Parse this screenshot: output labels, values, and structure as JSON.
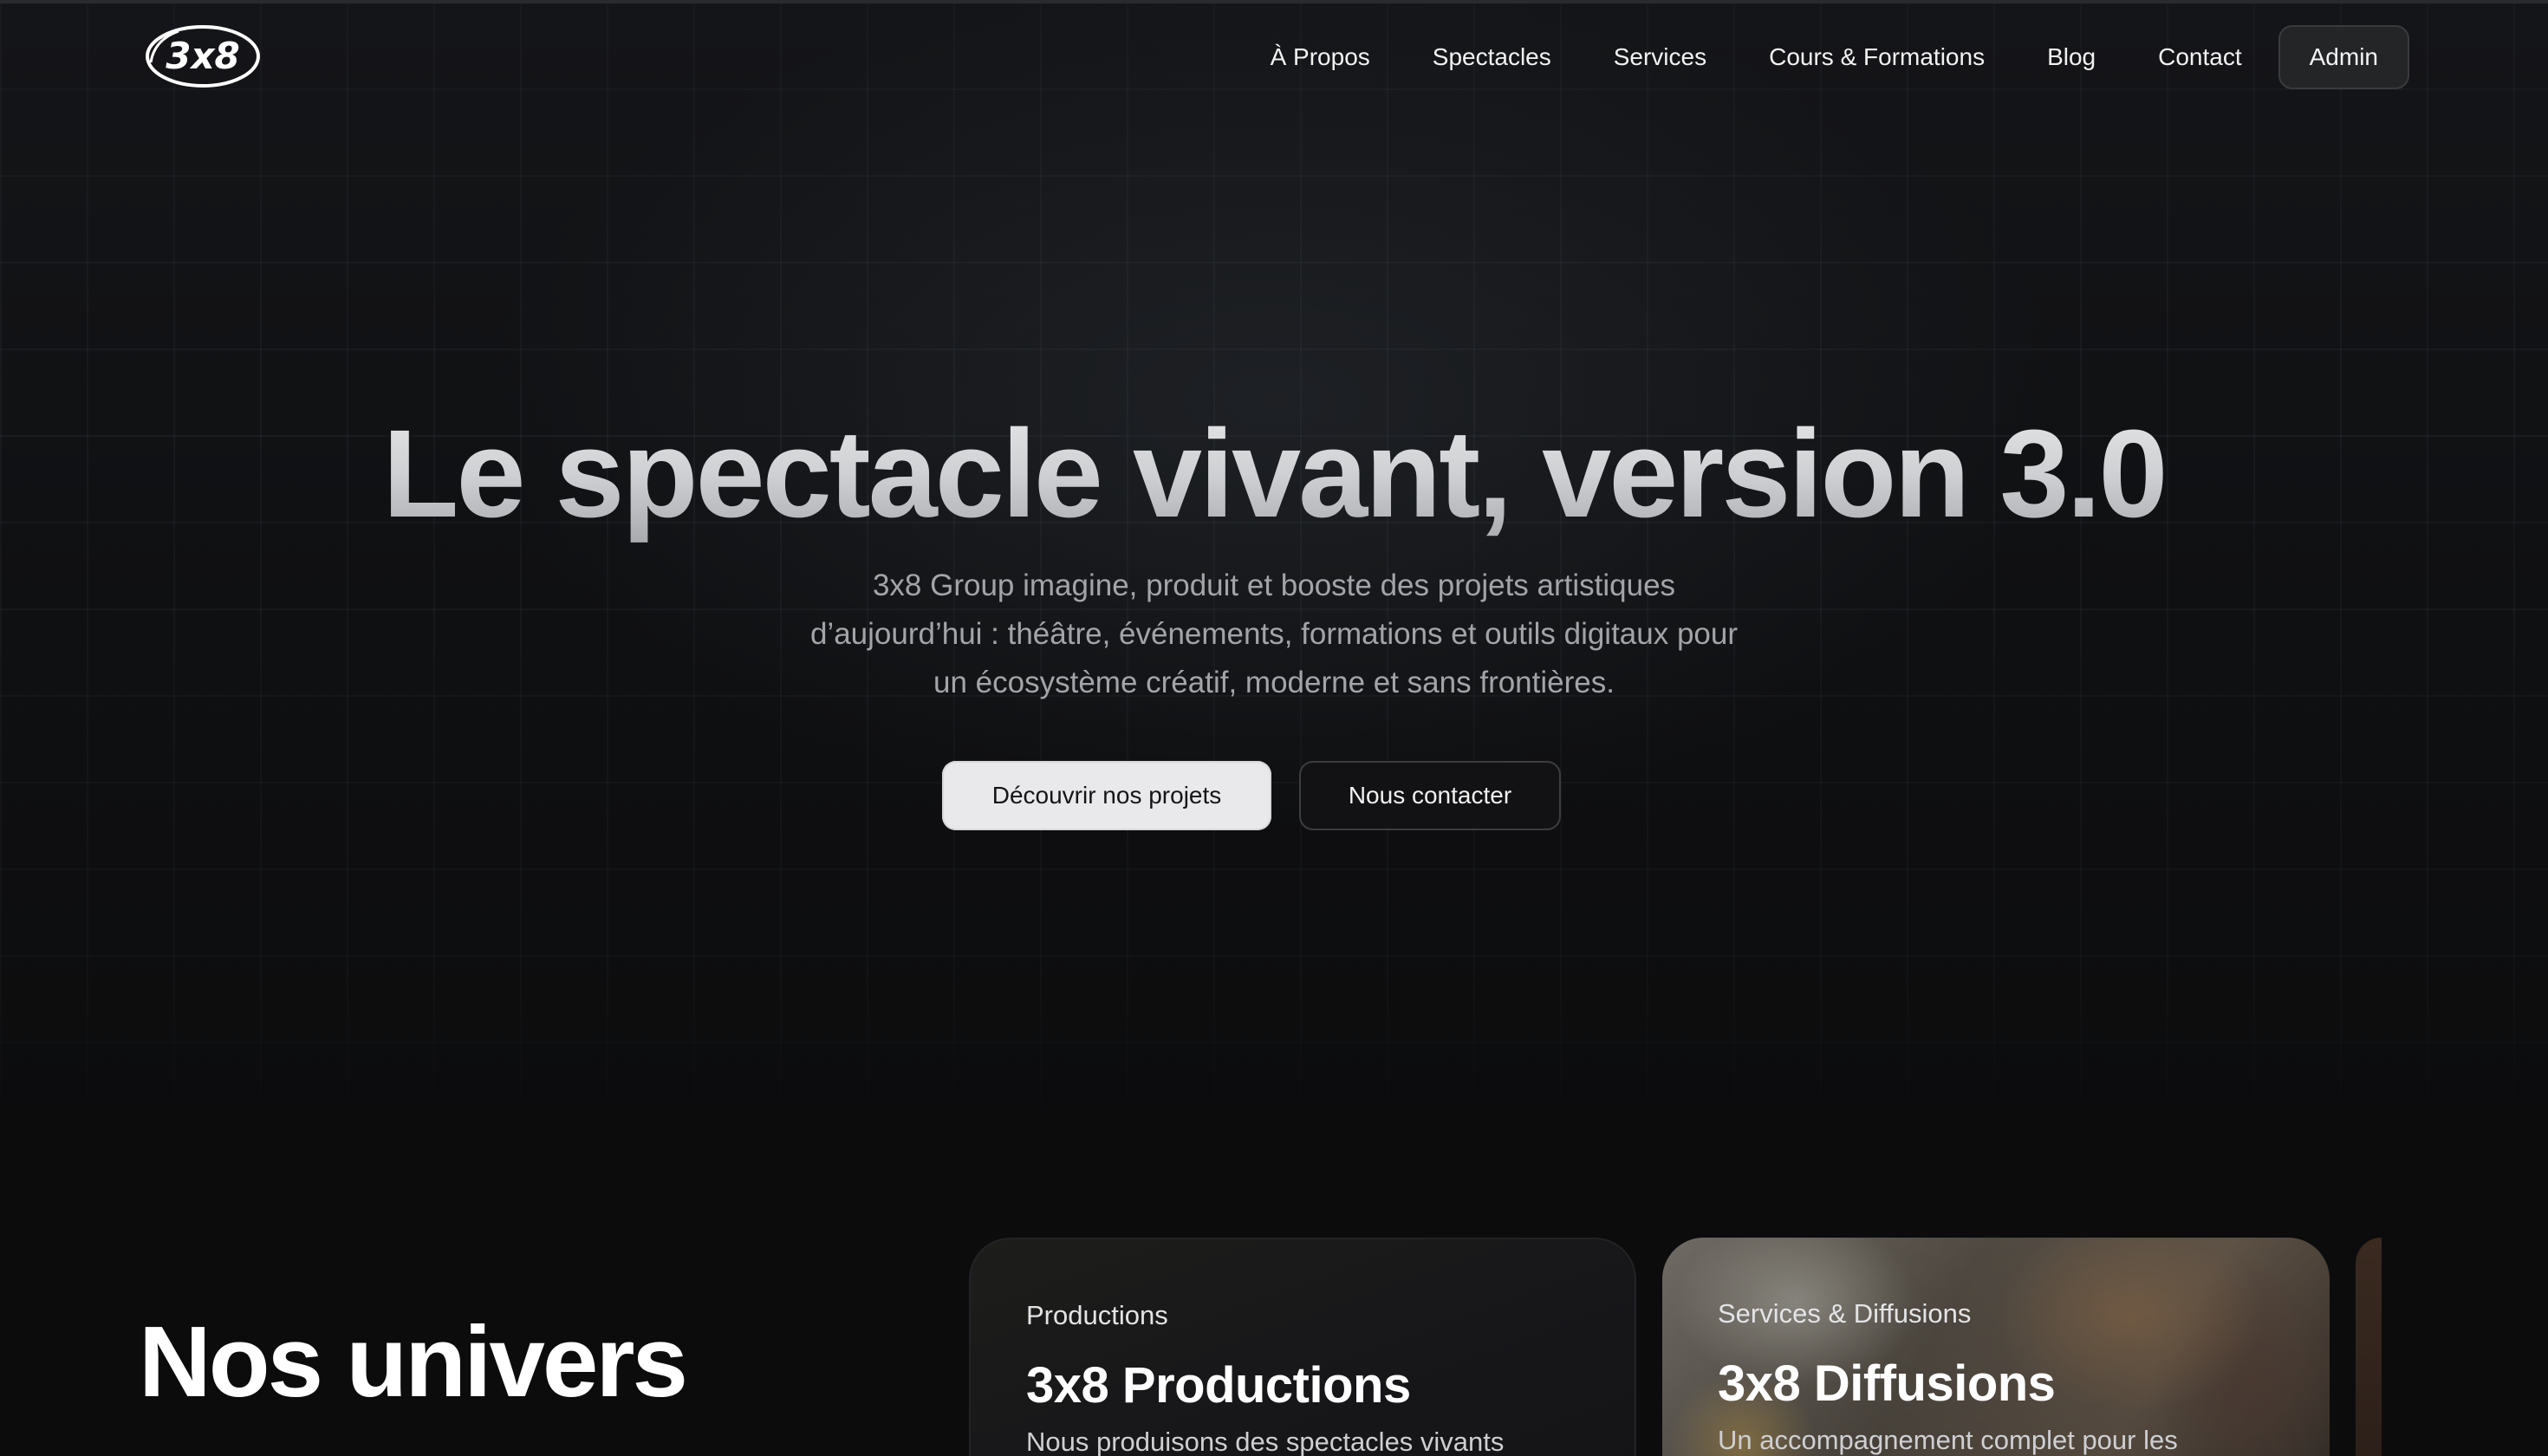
{
  "brand": {
    "logo_text": "3x8"
  },
  "nav": {
    "links": [
      {
        "label": "À Propos"
      },
      {
        "label": "Spectacles"
      },
      {
        "label": "Services"
      },
      {
        "label": "Cours & Formations"
      },
      {
        "label": "Blog"
      },
      {
        "label": "Contact"
      }
    ],
    "admin_label": "Admin"
  },
  "hero": {
    "title": "Le spectacle vivant, version 3.0",
    "subtitle_lines": [
      "3x8 Group imagine, produit et booste des projets artistiques",
      "d’aujourd’hui : théâtre, événements, formations et outils digitaux pour",
      "un écosystème créatif, moderne et sans frontières."
    ],
    "primary_cta": "Découvrir nos projets",
    "secondary_cta": "Nous contacter"
  },
  "univers": {
    "title": "Nos univers",
    "cards": [
      {
        "eyebrow": "Productions",
        "title": "3x8 Productions",
        "description": "Nous produisons des spectacles vivants"
      },
      {
        "eyebrow": "Services & Diffusions",
        "title": "3x8 Diffusions",
        "description": "Un accompagnement complet pour les"
      }
    ]
  },
  "colors": {
    "background": "#0c0c0d",
    "primary_button": "#e9e9eb",
    "admin_button": "#242527",
    "text": "#ffffff",
    "muted_text": "#a3a4a8"
  }
}
